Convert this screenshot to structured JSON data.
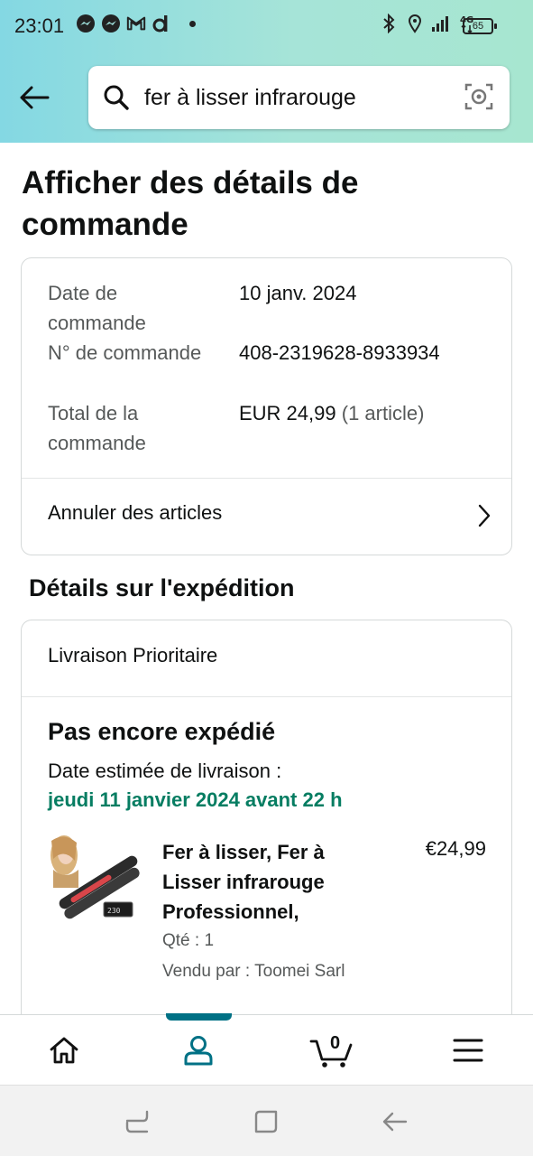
{
  "status_bar": {
    "time": "23:01",
    "battery": "65",
    "left_icons": [
      "messenger-icon",
      "messenger-icon",
      "gmail-icon",
      "d-app-icon"
    ],
    "right_icons": [
      "bluetooth-icon",
      "location-icon",
      "signal-icon",
      "4g-icon",
      "battery-icon"
    ]
  },
  "search": {
    "query": "fer à lisser infrarouge"
  },
  "page": {
    "title": "Afficher des détails de commande"
  },
  "order_summary": {
    "rows": [
      {
        "label": "Date de commande",
        "value": "10 janv. 2024",
        "extra": ""
      },
      {
        "label": "N° de commande",
        "value": "408-2319628-8933934",
        "extra": ""
      },
      {
        "label": "Total de la commande",
        "value": "EUR 24,99",
        "extra": " (1 article)"
      }
    ],
    "cancel_link": "Annuler des articles"
  },
  "shipping": {
    "section_title": "Détails sur l'expédition",
    "method": "Livraison Prioritaire",
    "status": "Pas encore expédié",
    "eta_label": "Date estimée de livraison :",
    "eta_date": "jeudi 11 janvier 2024 avant 22 h",
    "item": {
      "title": "Fer à lisser, Fer à Lisser infrarouge Professionnel,",
      "price": "€24,99",
      "quantity": "Qté : 1",
      "seller": "Vendu par : Toomei Sarl"
    }
  },
  "bottom_nav": {
    "cart_count": "0",
    "active": "account",
    "accent_color": "#007185"
  },
  "colors": {
    "green_date": "#067d62",
    "muted_text": "#565959"
  }
}
